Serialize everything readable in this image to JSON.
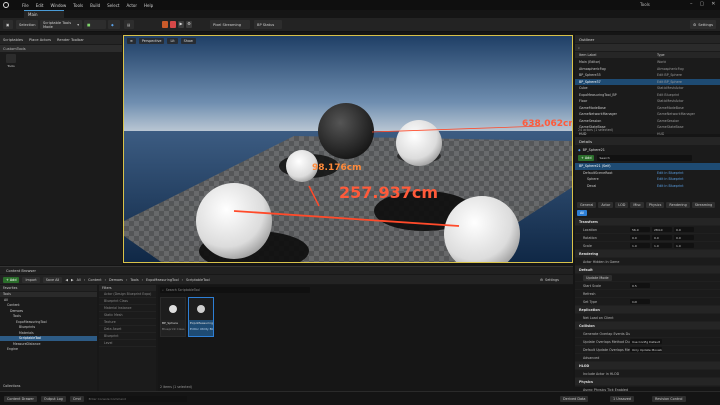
{
  "titlebar": {
    "menu": [
      "File",
      "Edit",
      "Window",
      "Tools",
      "Build",
      "Select",
      "Actor",
      "Help"
    ],
    "app_name": "Tools",
    "level_tab": "Main",
    "window_controls": [
      "–",
      "▢",
      "✕"
    ]
  },
  "toolbar": {
    "save_label": "",
    "mode": "Selection",
    "scriptable_tools": "Scriptable Tools Mode",
    "place_actors": "Place Actors",
    "world_toolbar": "Render Toolbar",
    "pixel_streaming": "Pixel Streaming",
    "bp_status": "BP Status",
    "settings": "Settings"
  },
  "left_panel": {
    "tabs": [
      "Scriptables",
      "Place Actors",
      "Render Toolbar"
    ],
    "header": "CustomTools",
    "item": "Tools"
  },
  "viewport": {
    "perspective": "Perspective",
    "lit": "Lit",
    "show": "Show",
    "measurements": [
      "638.062cm",
      "98.176cm",
      "257.937cm"
    ]
  },
  "outliner": {
    "title": "Outliner",
    "col_label": "Item Label",
    "col_type": "Type",
    "rows": [
      {
        "name": "Main (Editor)",
        "type": "World"
      },
      {
        "name": "AtmosphericFog",
        "type": "AtmosphericFog"
      },
      {
        "name": "BP_Sphere35",
        "type": "Edit BP_Sphere"
      },
      {
        "name": "BP_Sphere37",
        "type": "Edit BP_Sphere"
      },
      {
        "name": "Cube",
        "type": "StaticMeshActor"
      },
      {
        "name": "ExpoMeasuringTool_BP",
        "type": "Edit Blueprint"
      },
      {
        "name": "Floor",
        "type": "StaticMeshActor"
      },
      {
        "name": "GameModeBase",
        "type": "GameModeBase"
      },
      {
        "name": "GameNetworkManager",
        "type": "GameNetworkManager"
      },
      {
        "name": "GameSession",
        "type": "GameSession"
      },
      {
        "name": "GameStateBase",
        "type": "GameStateBase"
      },
      {
        "name": "HUD",
        "type": "HUD"
      }
    ],
    "footer": "24 actors (1 selected)"
  },
  "details": {
    "title": "Details",
    "object": "BP_Sphere21",
    "add_label": "+ Add",
    "search_placeholder": "Search",
    "components": [
      {
        "name": "BP_Sphere21 (Self)",
        "link": ""
      },
      {
        "name": "DefaultSceneRoot",
        "link": "Edit in Blueprint"
      },
      {
        "name": "Sphere",
        "link": "Edit in Blueprint"
      },
      {
        "name": "Decal",
        "link": "Edit in Blueprint"
      }
    ],
    "tabs": [
      "General",
      "Actor",
      "LOD",
      "Misc",
      "Physics",
      "Rendering",
      "Streaming",
      "All"
    ],
    "transform": {
      "category": "Transform",
      "location": [
        "56.0",
        "284.0",
        "0.0"
      ],
      "rotation": [
        "0.0",
        "0.0",
        "0.0"
      ],
      "scale": [
        "1.0",
        "1.0",
        "1.0"
      ]
    },
    "sections": [
      {
        "cat": "Rendering",
        "rows": [
          {
            "label": "Actor Hidden In Game",
            "value": ""
          }
        ]
      },
      {
        "cat": "Default",
        "rows": [
          {
            "label": "Update Mode",
            "value": ""
          }
        ]
      },
      {
        "cat": "",
        "rows": [
          {
            "label": "Start Scale",
            "value": "0.5"
          },
          {
            "label": "Refresh",
            "value": ""
          },
          {
            "label": "Set Type",
            "value": "Init"
          }
        ]
      },
      {
        "cat": "Replication",
        "rows": [
          {
            "label": "Net Load on Client",
            "value": ""
          }
        ]
      },
      {
        "cat": "Collision",
        "rows": [
          {
            "label": "Generate Overlap Events During",
            "value": ""
          },
          {
            "label": "Update Overlaps Method During",
            "value": "Use Config Default"
          },
          {
            "label": "Default Update Overlaps Method",
            "value": "Only Update Movable"
          }
        ]
      },
      {
        "cat": "Advanced",
        "rows": []
      },
      {
        "cat": "HLOD",
        "rows": [
          {
            "label": "Include Actor in HLOD",
            "value": ""
          }
        ]
      },
      {
        "cat": "Physics",
        "rows": [
          {
            "label": "Async Physics Tick Enabled",
            "value": ""
          }
        ]
      },
      {
        "cat": "Networking",
        "rows": []
      }
    ]
  },
  "content_browser": {
    "tab": "Content Browser",
    "add": "+ Add",
    "import": "Import",
    "save_all": "Save All",
    "path": [
      "All",
      "Content",
      "Demoes",
      "Tools",
      "ExpoMeasuringTool",
      "ScriptableTool"
    ],
    "settings": "Settings",
    "favorites": "Favorites",
    "tree_header": "Tools",
    "tree": [
      "All",
      "Content",
      "Demoes",
      "Tools",
      "ExpoMeasuringTool",
      "Blueprints",
      "Materials",
      "ScriptableTool",
      "MeasureDistance",
      "Engine"
    ],
    "filters_header": "Filters",
    "filters": [
      "Actor (Design Blueprint Expo)",
      "Blueprint Class",
      "Material Instance",
      "Static Mesh",
      "Texture",
      "Data Asset",
      "Blueprint",
      "Level"
    ],
    "search_placeholder": "Search ScriptableTool",
    "assets": [
      {
        "name": "BP_Sphere",
        "type": "Blueprint Class"
      },
      {
        "name": "ExpoMeasuringTool",
        "type": "Editor Utility Blueprint"
      }
    ],
    "count": "2 items (1 selected)",
    "collections": "Collections"
  },
  "statusbar": {
    "drawer": "Content Drawer",
    "output": "Output Log",
    "cmd": "Cmd",
    "console_placeholder": "Enter Console Command",
    "derived": "Derived Data",
    "unsaved": "1 Unsaved",
    "source": "Revision Control"
  },
  "colors": {
    "accent": "#2d7fd6",
    "selection": "#1e4b73",
    "measure": "#ff5a3a",
    "viewport_border": "#d8c24a"
  }
}
